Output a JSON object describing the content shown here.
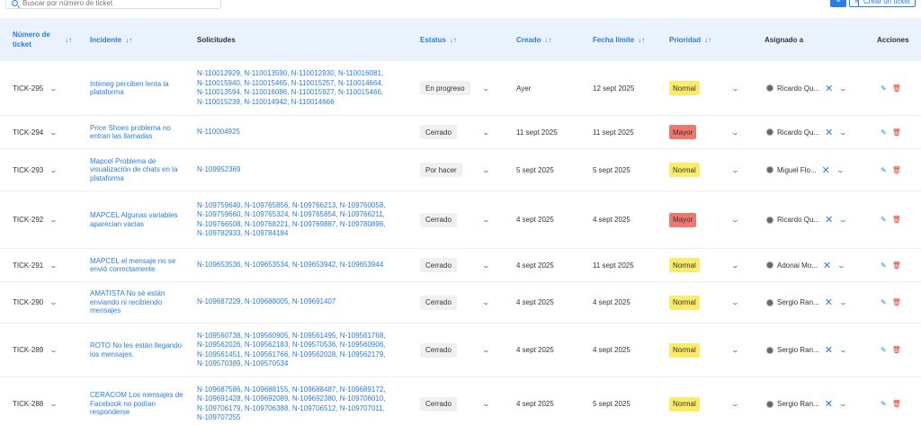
{
  "search": {
    "placeholder": "Buscar por número de ticket"
  },
  "toolbar": {
    "list_icon": "≡",
    "grid_icon": "⊞",
    "create_label": "Crear un ticket"
  },
  "columns": {
    "ticket": "Número de ticket",
    "incident": "Incidente",
    "requests": "Solicitudes",
    "status": "Estatus",
    "created": "Creado",
    "due": "Fecha límite",
    "priority": "Prioridad",
    "assigned": "Asignado a",
    "actions": "Acciones",
    "sort_icon": "↓↑"
  },
  "colors": {
    "accent": "#2a7de1",
    "normal": "#fbeb69",
    "mayor": "#f07670",
    "header_bg": "#eaf2fd"
  },
  "rows": [
    {
      "ticket": "TICK-295",
      "incident": "Inteneg perciben lenta la plataforma",
      "requests": "N-110012929, N-110013590, N-110012930, N-110016081, N-110015940, N-110015465, N-110015257, N-110014664, N-110013594, N-110016086, N-110015927, N-110015466, N-110015239, N-110014942, N-110014666",
      "status": "En progreso",
      "created": "Ayer",
      "due": "12 sept 2025",
      "priority": "Normal",
      "priority_level": "normal",
      "assignee": "Ricardo Qu..."
    },
    {
      "ticket": "TICK-294",
      "incident": "Price Shoes problema no entran las llamadas",
      "requests": "N-110004925",
      "status": "Cerrado",
      "created": "11 sept 2025",
      "due": "11 sept 2025",
      "priority": "Mayor",
      "priority_level": "mayor",
      "assignee": "Ricardo Qu..."
    },
    {
      "ticket": "TICK-293",
      "incident": "Mapcel Problema de visualización de chats en la plataforma",
      "requests": "N-109952369",
      "status": "Por hacer",
      "created": "5 sept 2025",
      "due": "5 sept 2025",
      "priority": "Normal",
      "priority_level": "normal",
      "assignee": "Miguel Flo..."
    },
    {
      "ticket": "TICK-292",
      "incident": "MAPCEL Algunas variables aparecian vacias",
      "requests": "N-109759640, N-109765856, N-109766213, N-109760058, N-109759660, N-109765324, N-109765854, N-109766211, N-109766508, N-109768221, N-109769887, N-109780896, N-109782933, N-109784184",
      "status": "Cerrado",
      "created": "4 sept 2025",
      "due": "4 sept 2025",
      "priority": "Mayor",
      "priority_level": "mayor",
      "assignee": "Ricardo Qu..."
    },
    {
      "ticket": "TICK-291",
      "incident": "MAPCEL el mensaje no se envió correctamente",
      "requests": "N-109653536, N-109653534, N-109653942, N-109653944",
      "status": "Cerrado",
      "created": "4 sept 2025",
      "due": "11 sept 2025",
      "priority": "Normal",
      "priority_level": "normal",
      "assignee": "Adonai Mo..."
    },
    {
      "ticket": "TICK-290",
      "incident": "AMATISTA No sé están enviando ni recibiendo mensajes",
      "requests": "N-109687229, N-109688005, N-109691407",
      "status": "Cerrado",
      "created": "4 sept 2025",
      "due": "4 sept 2025",
      "priority": "Normal",
      "priority_level": "normal",
      "assignee": "Sergio Ran..."
    },
    {
      "ticket": "TICK-289",
      "incident": "ROTO No les están llegando los mensajes.",
      "requests": "N-109560738, N-109560905, N-109561495, N-109561768, N-109562026, N-109562183, N-109570536, N-109560906, N-109561451, N-109561766, N-109562028, N-109562179, N-109570389, N-109570534",
      "status": "Cerrado",
      "created": "4 sept 2025",
      "due": "4 sept 2025",
      "priority": "Normal",
      "priority_level": "normal",
      "assignee": "Sergio Ran..."
    },
    {
      "ticket": "TICK-288",
      "incident": "CERACOM Los mensajes de Facebook no podían responderse",
      "requests": "N-109687586, N-109688155, N-109688487, N-109689172, N-109691428, N-109692089, N-109692380, N-109706010, N-109706179, N-109706388, N-109706512, N-109707011, N-109707255",
      "status": "Cerrado",
      "created": "4 sept 2025",
      "due": "5 sept 2025",
      "priority": "Normal",
      "priority_level": "normal",
      "assignee": "Sergio Ran..."
    }
  ]
}
